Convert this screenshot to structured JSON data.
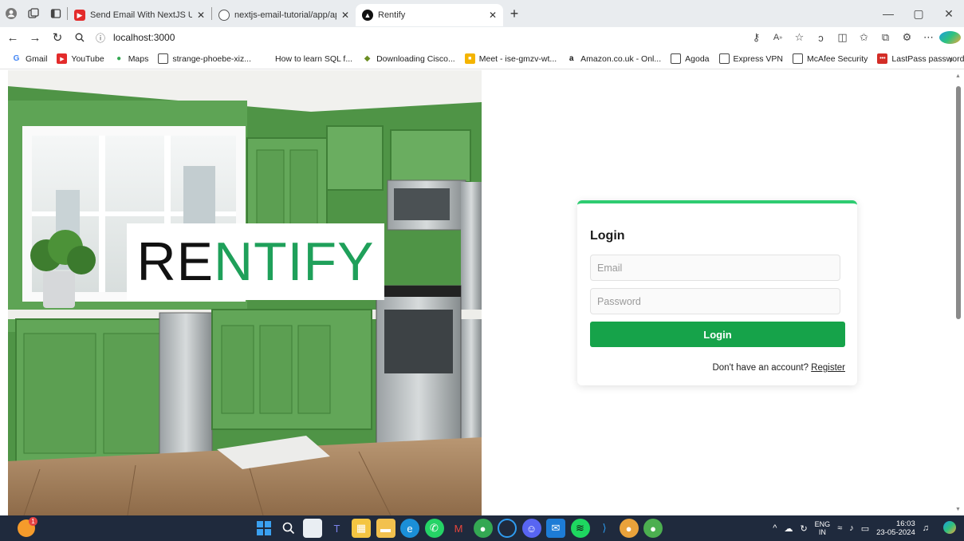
{
  "browser": {
    "tabs": [
      {
        "title": "Send Email With NextJS Using G",
        "active": false
      },
      {
        "title": "nextjs-email-tutorial/app/api/ser",
        "active": false
      },
      {
        "title": "Rentify",
        "active": true
      }
    ],
    "url": "localhost:3000"
  },
  "bookmarks": [
    "Gmail",
    "YouTube",
    "Maps",
    "strange-phoebe-xiz...",
    "How to learn SQL f...",
    "Downloading Cisco...",
    "Meet - ise-gmzv-wt...",
    "Amazon.co.uk - Onl...",
    "Agoda",
    "Express VPN",
    "McAfee Security",
    "LastPass password..."
  ],
  "hero": {
    "logo_part1": "RE",
    "logo_part2": "NTIFY"
  },
  "login": {
    "title": "Login",
    "email_placeholder": "Email",
    "password_placeholder": "Password",
    "submit_label": "Login",
    "register_prompt": "Don't have an account?",
    "register_link": "Register"
  },
  "taskbar": {
    "notification_count": "1",
    "lang_line1": "ENG",
    "lang_line2": "IN",
    "time": "16:03",
    "date": "23-05-2024"
  },
  "colors": {
    "accent": "#16a34a",
    "card_top_border": "#2ecc71",
    "logo_green": "#1fa05a"
  }
}
